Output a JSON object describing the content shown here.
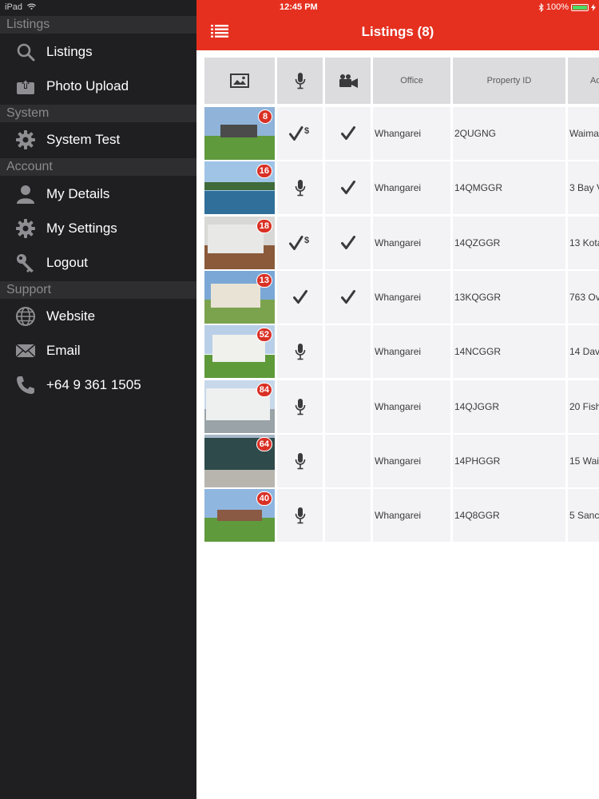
{
  "status_bar": {
    "device": "iPad",
    "time": "12:45 PM",
    "battery": "100%"
  },
  "sidebar": {
    "sections": [
      {
        "title": "Listings",
        "items": [
          {
            "label": "Listings",
            "icon": "search-icon"
          },
          {
            "label": "Photo Upload",
            "icon": "upload-icon"
          }
        ]
      },
      {
        "title": "System",
        "items": [
          {
            "label": "System Test",
            "icon": "gear-icon"
          }
        ]
      },
      {
        "title": "Account",
        "items": [
          {
            "label": "My Details",
            "icon": "person-icon"
          },
          {
            "label": "My Settings",
            "icon": "gear-icon"
          },
          {
            "label": "Logout",
            "icon": "key-icon"
          }
        ]
      },
      {
        "title": "Support",
        "items": [
          {
            "label": "Website",
            "icon": "globe-icon"
          },
          {
            "label": "Email",
            "icon": "envelope-icon"
          },
          {
            "label": "+64 9 361 1505",
            "icon": "phone-icon"
          }
        ]
      }
    ]
  },
  "header": {
    "title": "Listings (8)"
  },
  "table": {
    "columns": [
      {
        "key": "photo",
        "label": "",
        "icon": "photo-icon"
      },
      {
        "key": "audio",
        "label": "",
        "icon": "microphone-icon"
      },
      {
        "key": "video",
        "label": "",
        "icon": "video-camera-icon"
      },
      {
        "key": "office",
        "label": "Office"
      },
      {
        "key": "property_id",
        "label": "Property ID"
      },
      {
        "key": "address",
        "label": "Ad"
      }
    ],
    "rows": [
      {
        "photo_count": "8",
        "audio": "check-dollar",
        "video": "check",
        "office": "Whangarei",
        "property_id": "2QUGNG",
        "address": "Waima"
      },
      {
        "photo_count": "16",
        "audio": "microphone",
        "video": "check",
        "office": "Whangarei",
        "property_id": "14QMGGR",
        "address": "3 Bay V"
      },
      {
        "photo_count": "18",
        "audio": "check-dollar",
        "video": "check",
        "office": "Whangarei",
        "property_id": "14QZGGR",
        "address": "13 Kota"
      },
      {
        "photo_count": "13",
        "audio": "check",
        "video": "check",
        "office": "Whangarei",
        "property_id": "13KQGGR",
        "address": "763 Ov"
      },
      {
        "photo_count": "52",
        "audio": "microphone",
        "video": "",
        "office": "Whangarei",
        "property_id": "14NCGGR",
        "address": "14 Dav"
      },
      {
        "photo_count": "84",
        "audio": "microphone",
        "video": "",
        "office": "Whangarei",
        "property_id": "14QJGGR",
        "address": "20 Fish"
      },
      {
        "photo_count": "64",
        "audio": "microphone",
        "video": "",
        "office": "Whangarei",
        "property_id": "14PHGGR",
        "address": "15 Wai"
      },
      {
        "photo_count": "40",
        "audio": "microphone",
        "video": "",
        "office": "Whangarei",
        "property_id": "14Q8GGR",
        "address": "5 Sanc"
      }
    ]
  },
  "colors": {
    "accent": "#e53020",
    "sidebar_bg": "#1f1f21",
    "section_bg": "#2e2e30",
    "badge": "#d93025"
  }
}
